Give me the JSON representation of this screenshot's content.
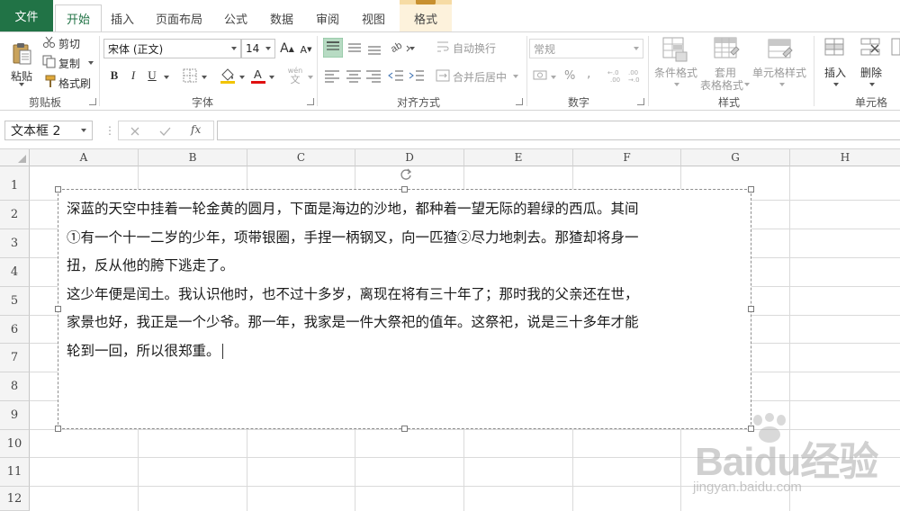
{
  "ribbon_tabs": [
    {
      "label": "文件"
    },
    {
      "label": "开始"
    },
    {
      "label": "插入"
    },
    {
      "label": "页面布局"
    },
    {
      "label": "公式"
    },
    {
      "label": "数据"
    },
    {
      "label": "审阅"
    },
    {
      "label": "视图"
    },
    {
      "label": "格式"
    }
  ],
  "active_tab": "开始",
  "clipboard": {
    "paste": "粘贴",
    "cut": "剪切",
    "copy": "复制",
    "format_painter": "格式刷",
    "group": "剪贴板"
  },
  "font": {
    "name": "宋体 (正文)",
    "size": "14",
    "grow": "A",
    "shrink": "A",
    "bold": "B",
    "italic": "I",
    "underline": "U",
    "wen": "wén",
    "wen_char": "文",
    "group": "字体"
  },
  "alignment": {
    "wrap_text": "自动换行",
    "merge_center": "合并后居中",
    "group": "对齐方式"
  },
  "number": {
    "format": "常规",
    "percent": "%",
    "comma": ",",
    "group": "数字"
  },
  "styles": {
    "conditional": "条件格式",
    "table_format_1": "套用",
    "table_format_2": "表格格式",
    "cell_styles": "单元格样式",
    "group": "样式"
  },
  "cells": {
    "insert": "插入",
    "delete": "删除",
    "group": "单元格"
  },
  "formula_bar": {
    "name_box": "文本框 2",
    "fx": "fx",
    "formula": ""
  },
  "columns": [
    "A",
    "B",
    "C",
    "D",
    "E",
    "F",
    "G",
    "H"
  ],
  "rows": [
    "1",
    "2",
    "3",
    "4",
    "5",
    "6",
    "7",
    "8",
    "9",
    "10",
    "11",
    "12"
  ],
  "textbox": {
    "lines": [
      "深蓝的天空中挂着一轮金黄的圆月，下面是海边的沙地，都种着一望无际的碧绿的西瓜。其间",
      "①有一个十一二岁的少年，项带银圈，手捏一柄钢叉，向一匹猹②尽力地刺去。那猹却将身一",
      "扭，反从他的胯下逃走了。",
      "这少年便是闰土。我认识他时，也不过十多岁，离现在将有三十年了；那时我的父亲还在世，",
      "家景也好，我正是一个少爷。那一年，我家是一件大祭祀的值年。这祭祀，说是三十多年才能",
      "轮到一回，所以很郑重。"
    ]
  },
  "watermark": {
    "logo": "Baidu经验",
    "sub": "jingyan.baidu.com"
  },
  "colors": {
    "excel_green": "#217346",
    "context_tab": "#f6dba4",
    "selected_align": "#b7dbc3"
  }
}
